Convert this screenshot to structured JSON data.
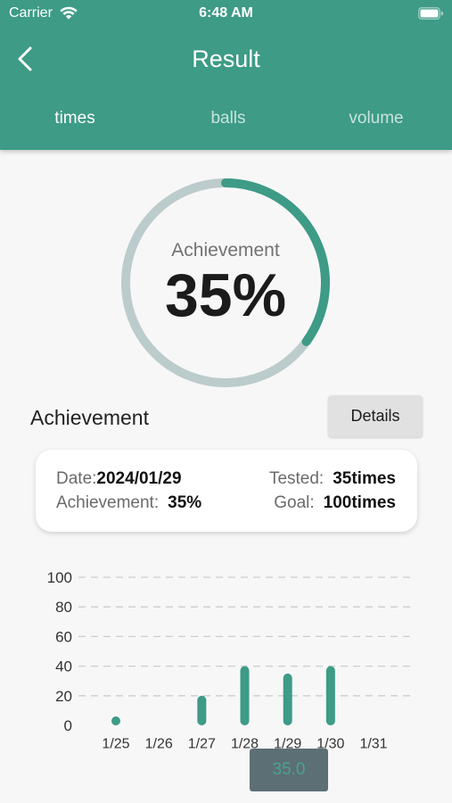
{
  "theme": {
    "primary": "#3d9b86",
    "background": "#f7f7f7",
    "ring_track": "#bccbcb",
    "tooltip_background": "#566a70"
  },
  "status_bar": {
    "carrier": "Carrier",
    "time": "6:48 AM",
    "wifi_icon": "wifi-icon",
    "battery_icon": "battery-icon"
  },
  "header": {
    "back_icon": "chevron-left-icon",
    "title": "Result",
    "tabs": [
      {
        "label": "times",
        "active": true
      },
      {
        "label": "balls",
        "active": false
      },
      {
        "label": "volume",
        "active": false
      }
    ]
  },
  "ring": {
    "label": "Achievement",
    "value_text": "35%",
    "progress_percent": 35
  },
  "section": {
    "title": "Achievement",
    "details_label": "Details"
  },
  "summary": {
    "date_label": "Date:",
    "date_value": "2024/01/29",
    "tested_label": "Tested:",
    "tested_value": "35times",
    "achievement_label": "Achievement:",
    "achievement_value": "35%",
    "goal_label": "Goal:",
    "goal_value": "100times"
  },
  "chart_data": {
    "type": "bar",
    "categories": [
      "1/25",
      "1/26",
      "1/27",
      "1/28",
      "1/29",
      "1/30",
      "1/31"
    ],
    "values": [
      5,
      0,
      20,
      40,
      35,
      40,
      0
    ],
    "ylim": [
      0,
      100
    ],
    "yticks": [
      0,
      20,
      40,
      60,
      80,
      100
    ],
    "grid": true,
    "tooltip": {
      "text": "35.0"
    }
  }
}
